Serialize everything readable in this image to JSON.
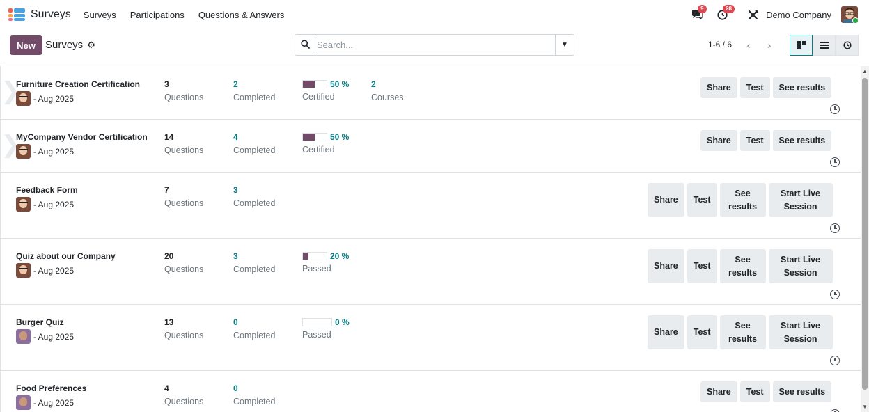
{
  "navbar": {
    "app_title": "Surveys",
    "menu": [
      "Surveys",
      "Participations",
      "Questions & Answers"
    ],
    "messages_count": "9",
    "activities_count": "28",
    "company": "Demo Company"
  },
  "control": {
    "new_label": "New",
    "breadcrumb": "Surveys",
    "search_placeholder": "Search...",
    "pager": "1-6 / 6"
  },
  "surveys": [
    {
      "title": "Furniture Creation Certification",
      "date": "- Aug 2025",
      "questions": "3",
      "questions_label": "Questions",
      "completed": "2",
      "completed_label": "Completed",
      "success_pct": "50 %",
      "success_value": 50,
      "success_label": "Certified",
      "courses": "2",
      "courses_label": "Courses",
      "actions": [
        "Share",
        "Test",
        "See results"
      ]
    },
    {
      "title": "MyCompany Vendor Certification",
      "date": "- Aug 2025",
      "questions": "14",
      "questions_label": "Questions",
      "completed": "4",
      "completed_label": "Completed",
      "success_pct": "50 %",
      "success_value": 50,
      "success_label": "Certified",
      "actions": [
        "Share",
        "Test",
        "See results"
      ]
    },
    {
      "title": "Feedback Form",
      "date": "- Aug 2025",
      "questions": "7",
      "questions_label": "Questions",
      "completed": "3",
      "completed_label": "Completed",
      "actions": [
        "Share",
        "Test",
        "See results",
        "Start Live Session"
      ]
    },
    {
      "title": "Quiz about our Company",
      "date": "- Aug 2025",
      "questions": "20",
      "questions_label": "Questions",
      "completed": "3",
      "completed_label": "Completed",
      "success_pct": "20 %",
      "success_value": 20,
      "success_label": "Passed",
      "actions": [
        "Share",
        "Test",
        "See results",
        "Start Live Session"
      ]
    },
    {
      "title": "Burger Quiz",
      "date": "- Aug 2025",
      "questions": "13",
      "questions_label": "Questions",
      "completed": "0",
      "completed_label": "Completed",
      "success_pct": "0 %",
      "success_value": 0,
      "success_label": "Passed",
      "actions": [
        "Share",
        "Test",
        "See results",
        "Start Live Session"
      ]
    },
    {
      "title": "Food Preferences",
      "date": "- Aug 2025",
      "questions": "4",
      "questions_label": "Questions",
      "completed": "0",
      "completed_label": "Completed",
      "actions": [
        "Share",
        "Test",
        "See results"
      ]
    }
  ],
  "icons": {
    "app_logo": "surveys-app-icon",
    "messages": "chat-icon",
    "activities": "clock-icon",
    "tools": "tools-icon",
    "settings": "gear-icon",
    "search": "search-icon",
    "dropdown": "caret-down-icon",
    "prev": "chevron-left-icon",
    "next": "chevron-right-icon",
    "kanban": "kanban-view-icon",
    "list": "list-view-icon",
    "activity_view": "activity-view-icon"
  },
  "colors": {
    "brand": "#714b67",
    "teal": "#017e84",
    "badge": "#e0464f"
  }
}
